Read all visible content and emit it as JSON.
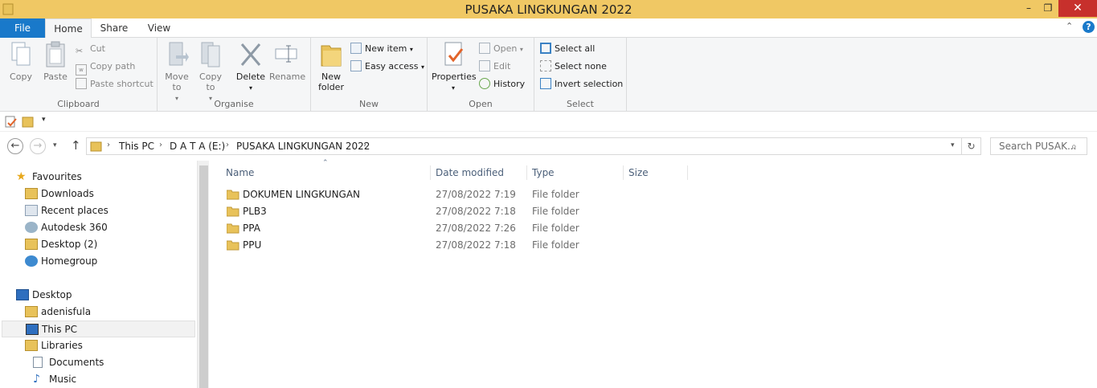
{
  "window": {
    "title": "PUSAKA LINGKUNGAN 2022",
    "minimize": "–",
    "maximize": "❐",
    "close": "✕"
  },
  "tabs": {
    "file": "File",
    "home": "Home",
    "share": "Share",
    "view": "View"
  },
  "ribbon": {
    "clipboard": {
      "label": "Clipboard",
      "copy": "Copy",
      "paste": "Paste",
      "cut": "Cut",
      "copy_path": "Copy path",
      "paste_shortcut": "Paste shortcut"
    },
    "organise": {
      "label": "Organise",
      "move_to": "Move to",
      "copy_to": "Copy to",
      "delete": "Delete",
      "rename": "Rename"
    },
    "new": {
      "label": "New",
      "new_folder": "New folder",
      "new_item": "New item",
      "easy_access": "Easy access"
    },
    "open": {
      "label": "Open",
      "properties": "Properties",
      "open": "Open",
      "edit": "Edit",
      "history": "History"
    },
    "select": {
      "label": "Select",
      "select_all": "Select all",
      "select_none": "Select none",
      "invert_selection": "Invert selection"
    }
  },
  "breadcrumb": [
    "This PC",
    "D A T A (E:)",
    "PUSAKA LINGKUNGAN 2022"
  ],
  "search": {
    "placeholder": "Search PUSAK..."
  },
  "nav_pane": {
    "favourites": "Favourites",
    "favourite_items": [
      "Downloads",
      "Recent places",
      "Autodesk 360",
      "Desktop (2)",
      "Homegroup"
    ],
    "desktop": "Desktop",
    "desktop_items": [
      "adenisfula",
      "This PC",
      "Libraries"
    ],
    "library_items": [
      "Documents",
      "Music"
    ]
  },
  "columns": {
    "name": "Name",
    "date_modified": "Date modified",
    "type": "Type",
    "size": "Size"
  },
  "files": [
    {
      "name": "DOKUMEN LINGKUNGAN",
      "date": "27/08/2022 7:19",
      "type": "File folder"
    },
    {
      "name": "PLB3",
      "date": "27/08/2022 7:18",
      "type": "File folder"
    },
    {
      "name": "PPA",
      "date": "27/08/2022 7:26",
      "type": "File folder"
    },
    {
      "name": "PPU",
      "date": "27/08/2022 7:18",
      "type": "File folder"
    }
  ],
  "colors": {
    "titlebar": "#f0c864",
    "file_tab": "#1979ca",
    "close": "#c7302c",
    "folder": "#e8c25a"
  }
}
